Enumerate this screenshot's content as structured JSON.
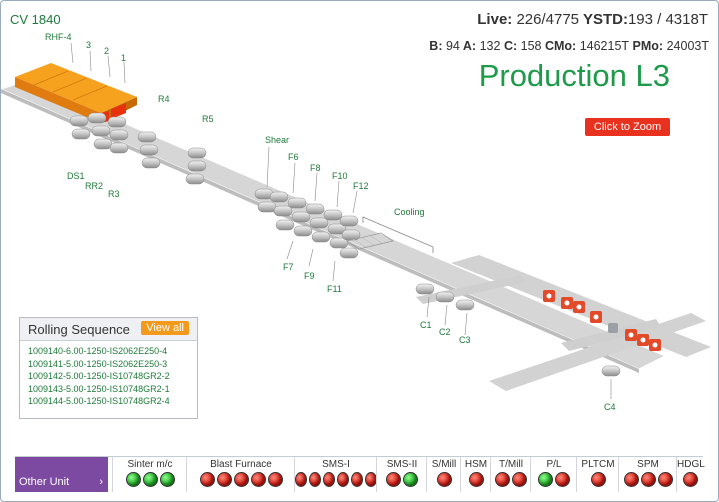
{
  "header": {
    "cv": "CV 1840",
    "live_label": "Live:",
    "live_value": "226/4775",
    "ystd_label": "YSTD:",
    "ystd_value": "193 / 4318T",
    "b_label": "B:",
    "b_value": "94",
    "a_label": "A:",
    "a_value": "132",
    "c_label": "C:",
    "c_value": "158",
    "cmo_label": "CMo:",
    "cmo_value": "146215T",
    "pmo_label": "PMo:",
    "pmo_value": "24003T",
    "title": "Production L3"
  },
  "zoom_button": "Click to Zoom",
  "mill_labels": {
    "rhf": "RHF-4",
    "z3": "3",
    "z2": "2",
    "z1": "1",
    "r4": "R4",
    "r5": "R5",
    "ds1": "DS1",
    "rr2": "RR2",
    "r3": "R3",
    "shear": "Shear",
    "f6": "F6",
    "f8": "F8",
    "f10": "F10",
    "f12": "F12",
    "f7": "F7",
    "f9": "F9",
    "f11": "F11",
    "cooling": "Cooling",
    "c1": "C1",
    "c2": "C2",
    "c3": "C3",
    "c4": "C4"
  },
  "rolling_sequence": {
    "title": "Rolling Sequence",
    "view_all": "View all",
    "items": [
      "1009140-6.00-1250-IS2062E250-4",
      "1009141-5.00-1250-IS2062E250-3",
      "1009142-5.00-1250-IS10748GR2-2",
      "1009143-5.00-1250-IS10748GR2-1",
      "1009144-5.00-1250-IS10748GR2-4"
    ]
  },
  "status_bar": {
    "other_unit": "Other Unit",
    "arrow_icon": "chevron-right-icon",
    "colors": {
      "green": "#1faa24",
      "red": "#d41a10"
    },
    "units": [
      {
        "name": "Sinter m/c",
        "lights": [
          "green",
          "green",
          "green"
        ]
      },
      {
        "name": "Blast Furnace",
        "lights": [
          "red",
          "red",
          "red",
          "red",
          "red"
        ]
      },
      {
        "name": "SMS-I",
        "lights": [
          "red",
          "red",
          "red",
          "red",
          "red",
          "red"
        ]
      },
      {
        "name": "SMS-II",
        "lights": [
          "red",
          "green"
        ]
      },
      {
        "name": "S/Mill",
        "lights": [
          "red"
        ]
      },
      {
        "name": "HSM",
        "lights": [
          "red"
        ]
      },
      {
        "name": "T/Mill",
        "lights": [
          "red",
          "red"
        ]
      },
      {
        "name": "P/L",
        "lights": [
          "green",
          "red"
        ]
      },
      {
        "name": "PLTCM",
        "lights": [
          "red"
        ]
      },
      {
        "name": "SPM",
        "lights": [
          "red",
          "red",
          "red"
        ]
      },
      {
        "name": "HDGL",
        "lights": [
          "red"
        ]
      }
    ]
  }
}
